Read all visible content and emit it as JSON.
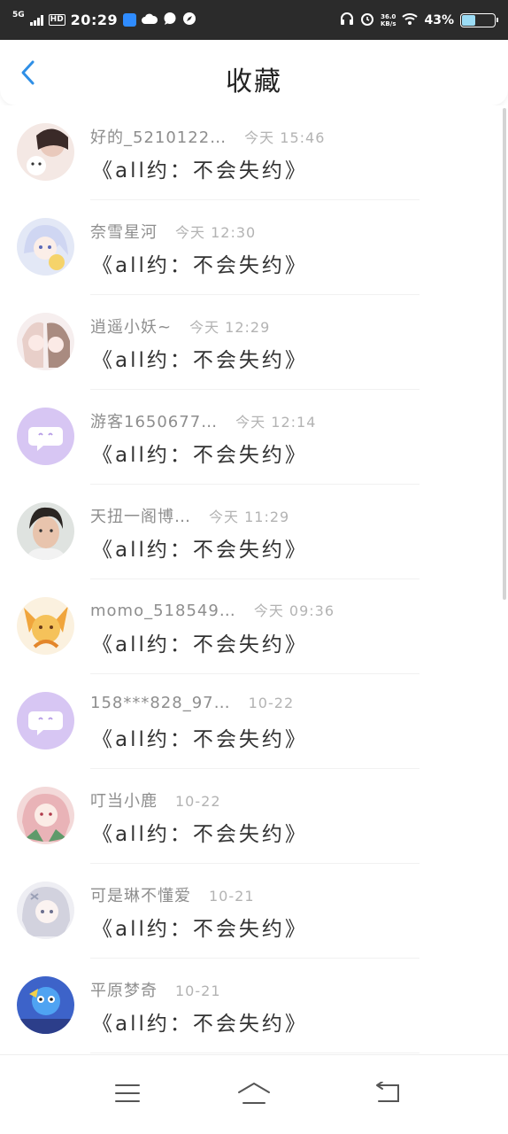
{
  "status_bar": {
    "network": "5G",
    "hd": "HD",
    "time": "20:29",
    "speed_value": "36.0",
    "speed_unit": "KB/s",
    "battery_percent": "43%",
    "battery_level": 0.43
  },
  "header": {
    "title": "收藏",
    "back_icon": "chevron-left-icon",
    "accent_color": "#2f8fe6"
  },
  "items": [
    {
      "name": "好的_5210122…",
      "time": "今天 15:46",
      "title": "《all约：不会失约》",
      "avatar_icon": "anime-avatar-1"
    },
    {
      "name": "奈雪星河",
      "time": "今天 12:30",
      "title": "《all约：不会失约》",
      "avatar_icon": "anime-avatar-2"
    },
    {
      "name": "逍遥小妖~",
      "time": "今天 12:29",
      "title": "《all约：不会失约》",
      "avatar_icon": "anime-avatar-3"
    },
    {
      "name": "游客1650677…",
      "time": "今天 12:14",
      "title": "《all约：不会失约》",
      "avatar_icon": "default-chat-avatar"
    },
    {
      "name": "天扭一阁博…",
      "time": "今天 11:29",
      "title": "《all约：不会失约》",
      "avatar_icon": "photo-avatar"
    },
    {
      "name": "momo_518549…",
      "time": "今天 09:36",
      "title": "《all约：不会失约》",
      "avatar_icon": "anime-avatar-4"
    },
    {
      "name": "158***828_97…",
      "time": "10-22",
      "title": "《all约：不会失约》",
      "avatar_icon": "default-chat-avatar"
    },
    {
      "name": "叮当小鹿",
      "time": "10-22",
      "title": "《all约：不会失约》",
      "avatar_icon": "anime-avatar-5"
    },
    {
      "name": "可是琳不懂爱",
      "time": "10-21",
      "title": "《all约：不会失约》",
      "avatar_icon": "anime-avatar-6"
    },
    {
      "name": "平原梦奇",
      "time": "10-21",
      "title": "《all约：不会失约》",
      "avatar_icon": "game-avatar"
    }
  ],
  "bottom_nav": {
    "menu_icon": "menu-icon",
    "home_icon": "home-icon",
    "back_icon": "back-icon"
  }
}
